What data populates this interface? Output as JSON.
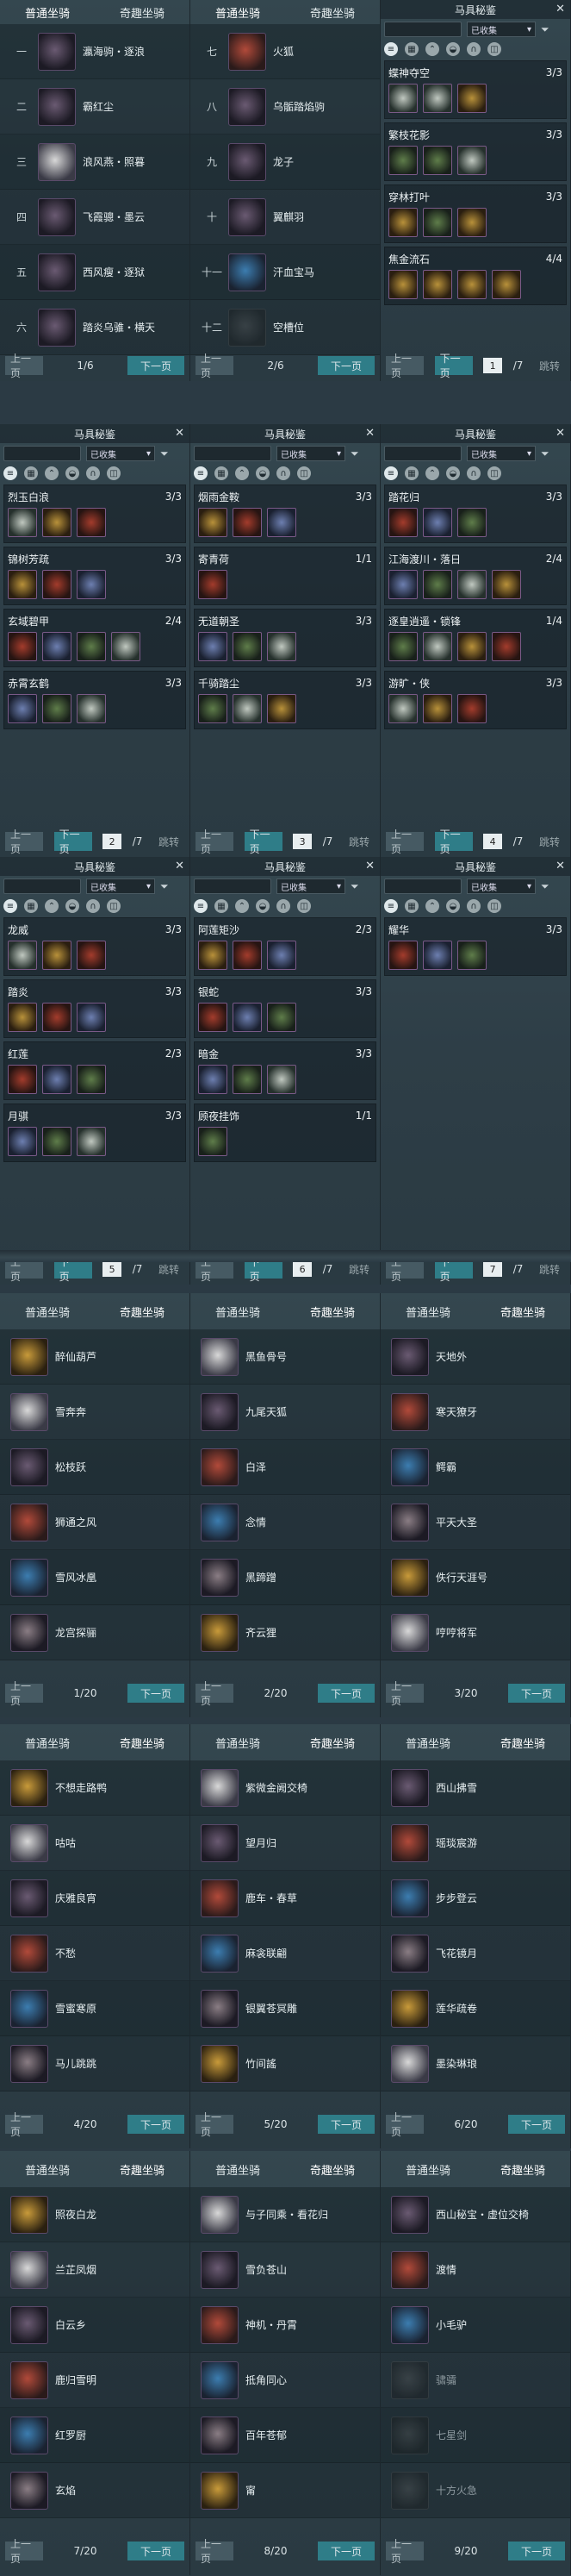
{
  "labels": {
    "normal_tab": "普通坐骑",
    "fun_tab": "奇趣坐骑",
    "prev": "上一页",
    "next": "下一页",
    "jump": "跳转",
    "guide_title": "马具秘鉴",
    "close": "✕",
    "filter_selected": "已收集",
    "filter_arrow": "▾"
  },
  "row1": {
    "p1": {
      "rows": [
        {
          "i": "一",
          "n": "瀛海驹・逐浪"
        },
        {
          "i": "二",
          "n": "霸红尘"
        },
        {
          "i": "三",
          "n": "浪风燕・照暮"
        },
        {
          "i": "四",
          "n": "飞霞骢・墨云"
        },
        {
          "i": "五",
          "n": "西风瘦・逐狱"
        },
        {
          "i": "六",
          "n": "踏炎乌骓・横天"
        }
      ],
      "page": "1/6"
    },
    "p2": {
      "rows": [
        {
          "i": "七",
          "n": "火狐"
        },
        {
          "i": "八",
          "n": "乌骺踏焰驹"
        },
        {
          "i": "九",
          "n": "龙子"
        },
        {
          "i": "十",
          "n": "翼麒羽"
        },
        {
          "i": "十一",
          "n": "汗血宝马"
        },
        {
          "i": "十二",
          "n": "空槽位"
        }
      ],
      "page": "2/6"
    },
    "p3": {
      "sets": [
        {
          "n": "蝶神夺空",
          "c": "3/3",
          "k": 3
        },
        {
          "n": "繁枝花影",
          "c": "3/3",
          "k": 3
        },
        {
          "n": "穿林打叶",
          "c": "3/3",
          "k": 3
        },
        {
          "n": "焦金流石",
          "c": "4/4",
          "k": 4
        }
      ],
      "pg": "1",
      "tot": "/7"
    }
  },
  "row2": [
    {
      "sets": [
        {
          "n": "烈玉白浪",
          "c": "3/3",
          "k": 3
        },
        {
          "n": "锦树芳疏",
          "c": "3/3",
          "k": 3
        },
        {
          "n": "玄域碧甲",
          "c": "2/4",
          "k": 4
        },
        {
          "n": "赤霄玄鹤",
          "c": "3/3",
          "k": 3
        }
      ],
      "pg": "2",
      "tot": "/7"
    },
    {
      "sets": [
        {
          "n": "烟雨金鞍",
          "c": "3/3",
          "k": 3
        },
        {
          "n": "寄青荷",
          "c": "1/1",
          "k": 1
        },
        {
          "n": "无道朝圣",
          "c": "3/3",
          "k": 3
        },
        {
          "n": "千骑踏尘",
          "c": "3/3",
          "k": 3
        }
      ],
      "pg": "3",
      "tot": "/7"
    },
    {
      "sets": [
        {
          "n": "踏花归",
          "c": "3/3",
          "k": 3
        },
        {
          "n": "江海渡川・落日",
          "c": "2/4",
          "k": 4
        },
        {
          "n": "逐皇逍遥・锁锋",
          "c": "1/4",
          "k": 4
        },
        {
          "n": "游旷・侠",
          "c": "3/3",
          "k": 3
        }
      ],
      "pg": "4",
      "tot": "/7"
    }
  ],
  "row3": [
    {
      "sets": [
        {
          "n": "龙威",
          "c": "3/3",
          "k": 3
        },
        {
          "n": "踏炎",
          "c": "3/3",
          "k": 3
        },
        {
          "n": "红莲",
          "c": "2/3",
          "k": 3
        },
        {
          "n": "月骐",
          "c": "3/3",
          "k": 3
        }
      ],
      "pg": "5",
      "tot": "/7"
    },
    {
      "sets": [
        {
          "n": "阿莲矩沙",
          "c": "2/3",
          "k": 3
        },
        {
          "n": "银蛇",
          "c": "3/3",
          "k": 3
        },
        {
          "n": "暗金",
          "c": "3/3",
          "k": 3
        },
        {
          "n": "顾夜挂饰",
          "c": "1/1",
          "k": 1
        }
      ],
      "pg": "6",
      "tot": "/7"
    },
    {
      "sets": [
        {
          "n": "耀华",
          "c": "3/3",
          "k": 3
        }
      ],
      "pg": "7",
      "tot": "/7"
    }
  ],
  "row4": [
    {
      "items": [
        "醉仙葫芦",
        "雪奔奔",
        "松枝跃",
        "狮通之风",
        "雪风冰凰",
        "龙宫探骊"
      ],
      "page": "1/20"
    },
    {
      "items": [
        "黑鱼骨号",
        "九尾天狐",
        "白泽",
        "念情",
        "黑蹄蹭",
        "齐云狸"
      ],
      "page": "2/20"
    },
    {
      "items": [
        "天地外",
        "寒天獠牙",
        "鳄霸",
        "平天大圣",
        "佚行天涯号",
        "哼哼将军"
      ],
      "page": "3/20"
    }
  ],
  "row5": [
    {
      "items": [
        "不想走路鸭",
        "咕咕",
        "庆雅良宵",
        "不愁",
        "雪蜜寒原",
        "马儿跳跳"
      ],
      "page": "4/20"
    },
    {
      "items": [
        "紫微金阙交椅",
        "望月归",
        "鹿车・春草",
        "麻衾联翩",
        "银翼苍冥雕",
        "竹间謠"
      ],
      "page": "5/20"
    },
    {
      "items": [
        "西山拂雪",
        "瑶琰宸游",
        "步步登云",
        "飞花镜月",
        "莲华疏卷",
        "墨染琳琅"
      ],
      "page": "6/20"
    }
  ],
  "row6": [
    {
      "items": [
        "照夜白龙",
        "兰芷凤烟",
        "白云乡",
        "鹿归雪明",
        "红罗厨",
        "玄焰"
      ],
      "page": "7/20"
    },
    {
      "items": [
        "与子同乘・看花归",
        "雪负苍山",
        "神机・丹霄",
        "抵角同心",
        "百年苍郁",
        "甯"
      ],
      "page": "8/20"
    },
    {
      "items": [
        "西山秘宝・虚位交椅",
        "渡情",
        "小毛驴",
        "骕骦",
        "七星剑",
        "十方火急"
      ],
      "page": "9/20"
    }
  ]
}
